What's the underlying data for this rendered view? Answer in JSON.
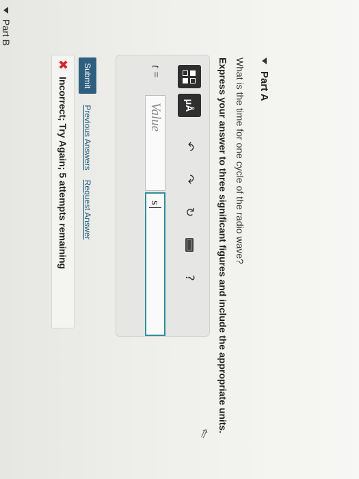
{
  "part_a": {
    "title": "Part A",
    "question": "What is the time for one cycle of the radio wave?",
    "instruction": "Express your answer to three significant figures and include the appropriate units."
  },
  "toolbar": {
    "buttons": [
      "templates-icon",
      "mu-angstrom-icon"
    ],
    "mu_label": "μÅ",
    "icons": [
      "undo-icon",
      "redo-icon",
      "reset-icon",
      "keyboard-icon",
      "help-icon"
    ],
    "undo_glyph": "↶",
    "redo_glyph": "↷",
    "reset_glyph": "↻",
    "help_glyph": "?"
  },
  "answer": {
    "variable_label": "t =",
    "value_placeholder": "Value",
    "units_value": "s"
  },
  "actions": {
    "submit_label": "Submit",
    "previous_answers_label": "Previous Answers",
    "request_answer_label": "Request Answer"
  },
  "feedback": {
    "icon": "✖",
    "text": "Incorrect; Try Again; 5 attempts remaining",
    "color": "#d8232a"
  },
  "part_b": {
    "title": "Part B"
  },
  "colors": {
    "submit_bg": "#2f5f7e",
    "link": "#1d5c7c",
    "units_border": "#2e8f9a"
  }
}
